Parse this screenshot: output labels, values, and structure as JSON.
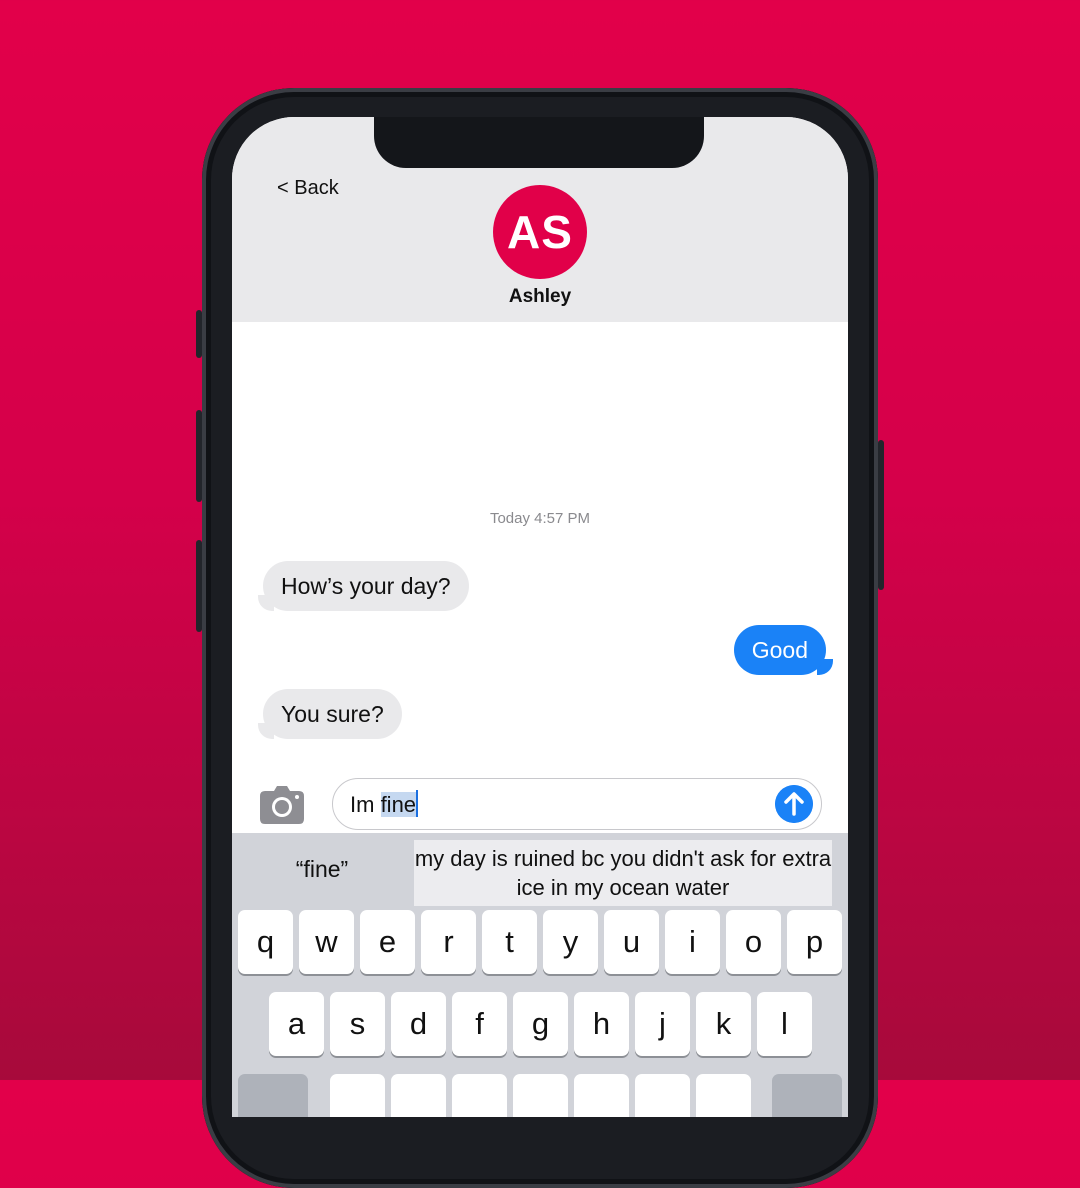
{
  "nav": {
    "back_label": "< Back"
  },
  "contact": {
    "initials": "AS",
    "name": "Ashley",
    "avatar_color": "#e10049"
  },
  "thread": {
    "timestamp": "Today 4:57 PM",
    "messages": [
      {
        "from": "them",
        "text": "How’s your day?"
      },
      {
        "from": "me",
        "text": "Good"
      },
      {
        "from": "them",
        "text": "You sure?"
      }
    ]
  },
  "composer": {
    "typed_prefix": "Im ",
    "selected_word": "fine",
    "camera_icon": "camera-icon",
    "send_icon": "arrow-up-icon"
  },
  "keyboard": {
    "suggestions": [
      "“fine”",
      "my day is ruined bc you didn't ask for extra ice in my ocean water"
    ],
    "rows": [
      [
        "q",
        "w",
        "e",
        "r",
        "t",
        "y",
        "u",
        "i",
        "o",
        "p"
      ],
      [
        "a",
        "s",
        "d",
        "f",
        "g",
        "h",
        "j",
        "k",
        "l"
      ]
    ]
  },
  "colors": {
    "background": "#e2004a",
    "outgoing_bubble": "#1a82f7",
    "incoming_bubble": "#e9e9eb"
  }
}
